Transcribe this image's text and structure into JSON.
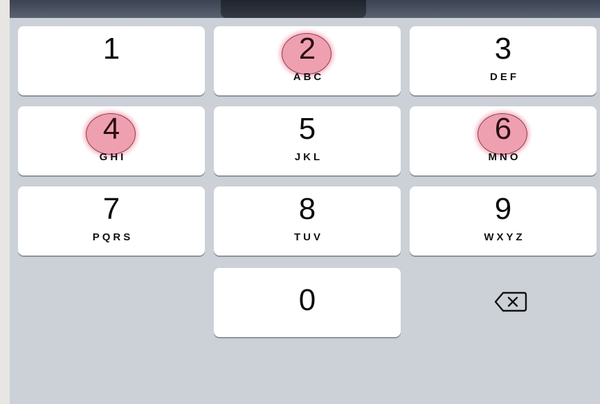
{
  "keypad": {
    "keys": [
      {
        "digit": "1",
        "letters": "",
        "highlighted": false
      },
      {
        "digit": "2",
        "letters": "ABC",
        "highlighted": true
      },
      {
        "digit": "3",
        "letters": "DEF",
        "highlighted": false
      },
      {
        "digit": "4",
        "letters": "GHI",
        "highlighted": true
      },
      {
        "digit": "5",
        "letters": "JKL",
        "highlighted": false
      },
      {
        "digit": "6",
        "letters": "MNO",
        "highlighted": true
      },
      {
        "digit": "7",
        "letters": "PQRS",
        "highlighted": false
      },
      {
        "digit": "8",
        "letters": "TUV",
        "highlighted": false
      },
      {
        "digit": "9",
        "letters": "WXYZ",
        "highlighted": false
      },
      {
        "digit": "0",
        "letters": "",
        "highlighted": false
      }
    ],
    "delete_icon": "backspace-icon",
    "highlight_color": "#e25270",
    "background_color": "#ccd0d7"
  }
}
